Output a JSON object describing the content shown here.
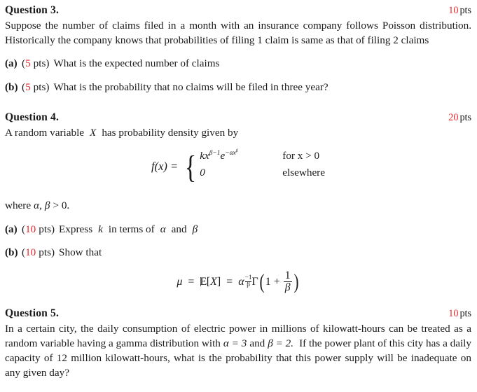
{
  "document": {
    "accent_red": "#e8262b",
    "text_color": "#1a1a1a",
    "background": "#ffffff"
  },
  "questions": [
    {
      "title": "Question 3.",
      "points_num": "10",
      "points_unit": "pts",
      "body": "Suppose the number of claims filed in a month with an insurance company follows Poisson distribution. Historically the company knows that probabilities of filing 1 claim is same as that of filing 2 claims",
      "parts": [
        {
          "label": "(a)",
          "points_open": "(",
          "points_num": "5",
          "points_unit": "pts)",
          "text": "What is the expected number of claims"
        },
        {
          "label": "(b)",
          "points_open": "(",
          "points_num": "5",
          "points_unit": "pts)",
          "text": "What is the probability that no claims will be filed in three year?"
        }
      ]
    },
    {
      "title": "Question 4.",
      "points_num": "20",
      "points_unit": "pts",
      "body": "A random variable X has probability density given by",
      "body_prefix": "A random variable",
      "body_var": "X",
      "body_suffix": "has probability density given by",
      "where_line": {
        "prefix": "where",
        "alpha": "α",
        "comma": ",",
        "beta": "β",
        "rel": "> 0."
      },
      "density": {
        "lhs": "f(x) =",
        "case1_value": "kx",
        "case1_exp1": "β−1",
        "case1_e": "e",
        "case1_exp2_base": "−αx",
        "case1_exp2_sup": "β",
        "case1_cond": "for x > 0",
        "case2_value": "0",
        "case2_cond": "elsewhere"
      },
      "parts": [
        {
          "label": "(a)",
          "points_open": "(",
          "points_num": "10",
          "points_unit": "pts)",
          "text": "Express k in terms of α and β",
          "text_pre": "Express",
          "text_k": "k",
          "text_mid": "in terms of",
          "text_alpha": "α",
          "text_and": "and",
          "text_beta": "β"
        },
        {
          "label": "(b)",
          "points_open": "(",
          "points_num": "10",
          "points_unit": "pts)",
          "text": "Show that"
        }
      ],
      "mu_equation": {
        "mu": "μ",
        "eq1": "=",
        "E": "E",
        "bracket_open": "[",
        "X": "X",
        "bracket_close": "]",
        "eq2": "=",
        "alpha": "α",
        "exp_sign": "−",
        "exp_num": "1",
        "exp_den": "β",
        "gamma": "Γ",
        "paren_open": "(",
        "one": "1 +",
        "frac_num": "1",
        "frac_den": "β",
        "paren_close": ")"
      }
    },
    {
      "title": "Question 5.",
      "points_num": "10",
      "points_unit": "pts",
      "body": "In a certain city, the daily consumption of electric power in millions of kilowatt-hours can be treated as a random variable having a gamma distribution with α = 3 and β = 2. If the power plant of this city has a daily capacity of 12 million kilowatt-hours, what is the probability that this power supply will be inadequate on any given day?",
      "body_seg1": "In a certain city, the daily consumption of electric power in millions of kilowatt-hours can be treated as a random variable having a gamma distribution with",
      "body_alpha": "α = 3",
      "body_and": "and",
      "body_beta": "β = 2.",
      "body_seg2": "If the power plant of this city has a daily capacity of 12 million kilowatt-hours, what is the probability that this power supply will be inadequate on any given day?"
    }
  ]
}
